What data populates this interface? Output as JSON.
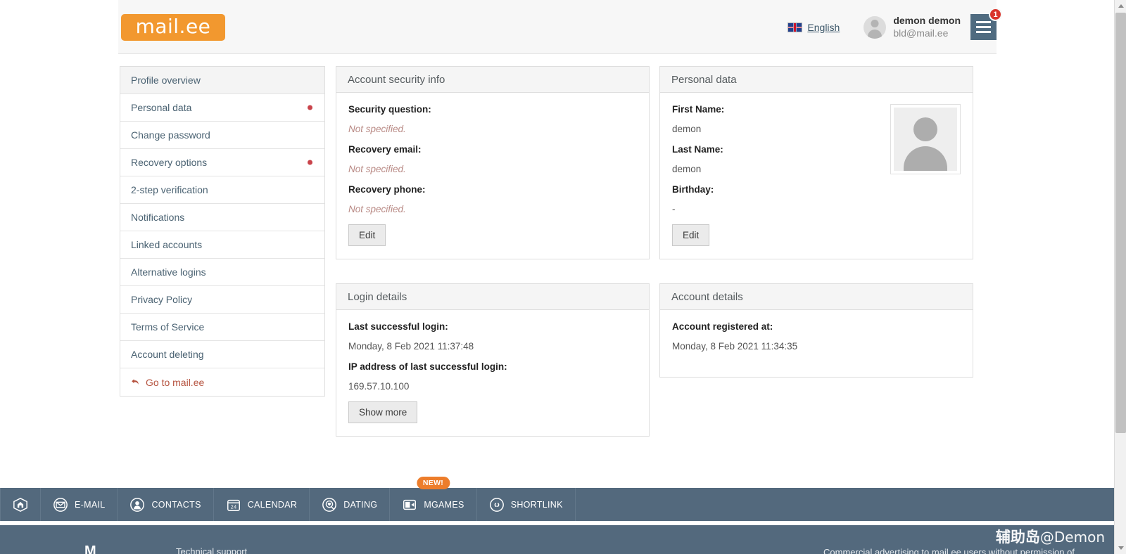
{
  "header": {
    "logo_text": "mail.ee",
    "language": "English",
    "language_icon": "uk-flag-icon",
    "user_name": "demon demon",
    "user_email": "bld@mail.ee",
    "notification_count": "1",
    "menu_icon": "hamburger-menu-icon",
    "avatar_icon": "user-avatar-icon"
  },
  "sidebar": {
    "items": [
      {
        "label": "Profile overview",
        "active": true,
        "dot": false
      },
      {
        "label": "Personal data",
        "active": false,
        "dot": true
      },
      {
        "label": "Change password",
        "active": false,
        "dot": false
      },
      {
        "label": "Recovery options",
        "active": false,
        "dot": true
      },
      {
        "label": "2-step verification",
        "active": false,
        "dot": false
      },
      {
        "label": "Notifications",
        "active": false,
        "dot": false
      },
      {
        "label": "Linked accounts",
        "active": false,
        "dot": false
      },
      {
        "label": "Alternative logins",
        "active": false,
        "dot": false
      },
      {
        "label": "Privacy Policy",
        "active": false,
        "dot": false
      },
      {
        "label": "Terms of Service",
        "active": false,
        "dot": false
      },
      {
        "label": "Account deleting",
        "active": false,
        "dot": false
      }
    ],
    "go_back": {
      "label": "Go to mail.ee",
      "icon": "back-arrow-icon"
    }
  },
  "panels": {
    "security": {
      "title": "Account security info",
      "fields": [
        {
          "label": "Security question:",
          "value": "Not specified.",
          "unset": true
        },
        {
          "label": "Recovery email:",
          "value": "Not specified.",
          "unset": true
        },
        {
          "label": "Recovery phone:",
          "value": "Not specified.",
          "unset": true
        }
      ],
      "button": "Edit"
    },
    "personal": {
      "title": "Personal data",
      "fields": [
        {
          "label": "First Name:",
          "value": "demon",
          "unset": false
        },
        {
          "label": "Last Name:",
          "value": "demon",
          "unset": false
        },
        {
          "label": "Birthday:",
          "value": "-",
          "unset": false
        }
      ],
      "button": "Edit",
      "avatar_icon": "profile-photo-placeholder-icon"
    },
    "login": {
      "title": "Login details",
      "fields": [
        {
          "label": "Last successful login:",
          "value": "Monday, 8 Feb 2021 11:37:48",
          "unset": false
        },
        {
          "label": "IP address of last successful login:",
          "value": "169.57.10.100",
          "unset": false
        }
      ],
      "button": "Show more"
    },
    "account": {
      "title": "Account details",
      "fields": [
        {
          "label": "Account registered at:",
          "value": "Monday, 8 Feb 2021 11:34:35",
          "unset": false
        }
      ]
    }
  },
  "bottom_nav": {
    "items": [
      {
        "label": "",
        "icon": "home-icon",
        "badge": ""
      },
      {
        "label": "E-MAIL",
        "icon": "envelope-icon",
        "badge": ""
      },
      {
        "label": "CONTACTS",
        "icon": "contacts-icon",
        "badge": ""
      },
      {
        "label": "CALENDAR",
        "icon": "calendar-icon",
        "badge": ""
      },
      {
        "label": "DATING",
        "icon": "dating-icon",
        "badge": ""
      },
      {
        "label": "MGAMES",
        "icon": "games-icon",
        "badge": "NEW!"
      },
      {
        "label": "SHORTLINK",
        "icon": "shortlink-icon",
        "badge": ""
      }
    ]
  },
  "footer": {
    "logo": "M",
    "support": "Technical support",
    "note": "Commercial advertising to mail.ee users without permission of"
  },
  "watermark": {
    "cjk": "辅助岛",
    "handle": "@Demon"
  },
  "colors": {
    "brand_orange": "#f2982f",
    "nav_slate": "#53697d",
    "accent_red": "#d9342b",
    "dot_red": "#c9434a",
    "link_brown": "#b5523e"
  }
}
